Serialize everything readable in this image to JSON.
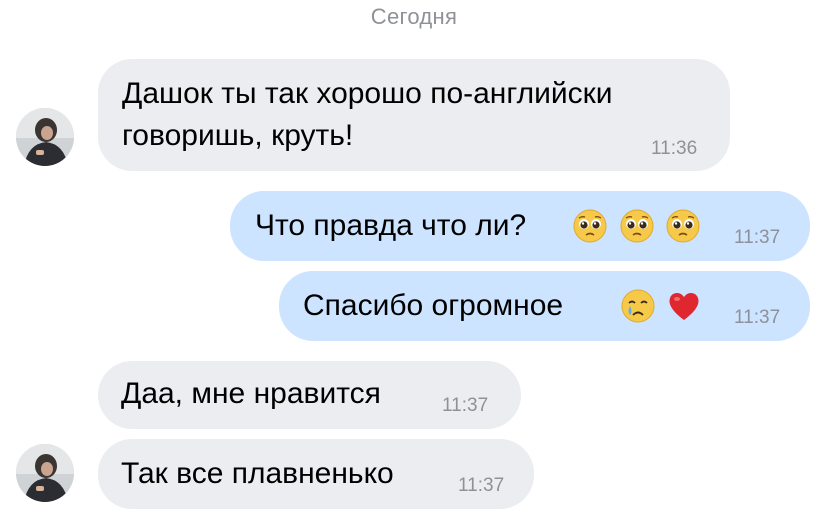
{
  "chat": {
    "date_separator": "Сегодня",
    "messages": [
      {
        "direction": "incoming",
        "lines": [
          "Дашок ты так хорошо по-английски",
          "говоришь, круть!"
        ],
        "time": "11:36"
      },
      {
        "direction": "outgoing",
        "text": "Что правда что ли?",
        "emojis": [
          "pleading-face-emoji",
          "pleading-face-emoji",
          "pleading-face-emoji"
        ],
        "time": "11:37"
      },
      {
        "direction": "outgoing",
        "text": "Спасибо огромное",
        "emojis": [
          "crying-face-emoji",
          "red-heart-emoji"
        ],
        "time": "11:37"
      },
      {
        "direction": "incoming",
        "text": "Даа, мне нравится",
        "time": "11:37"
      },
      {
        "direction": "incoming",
        "text": "Так все плавненько",
        "time": "11:37"
      }
    ]
  },
  "colors": {
    "incoming_bubble": "#ebedf0",
    "outgoing_bubble": "#cce4ff",
    "timestamp": "#8e9297",
    "date_separator": "#8e9297"
  }
}
